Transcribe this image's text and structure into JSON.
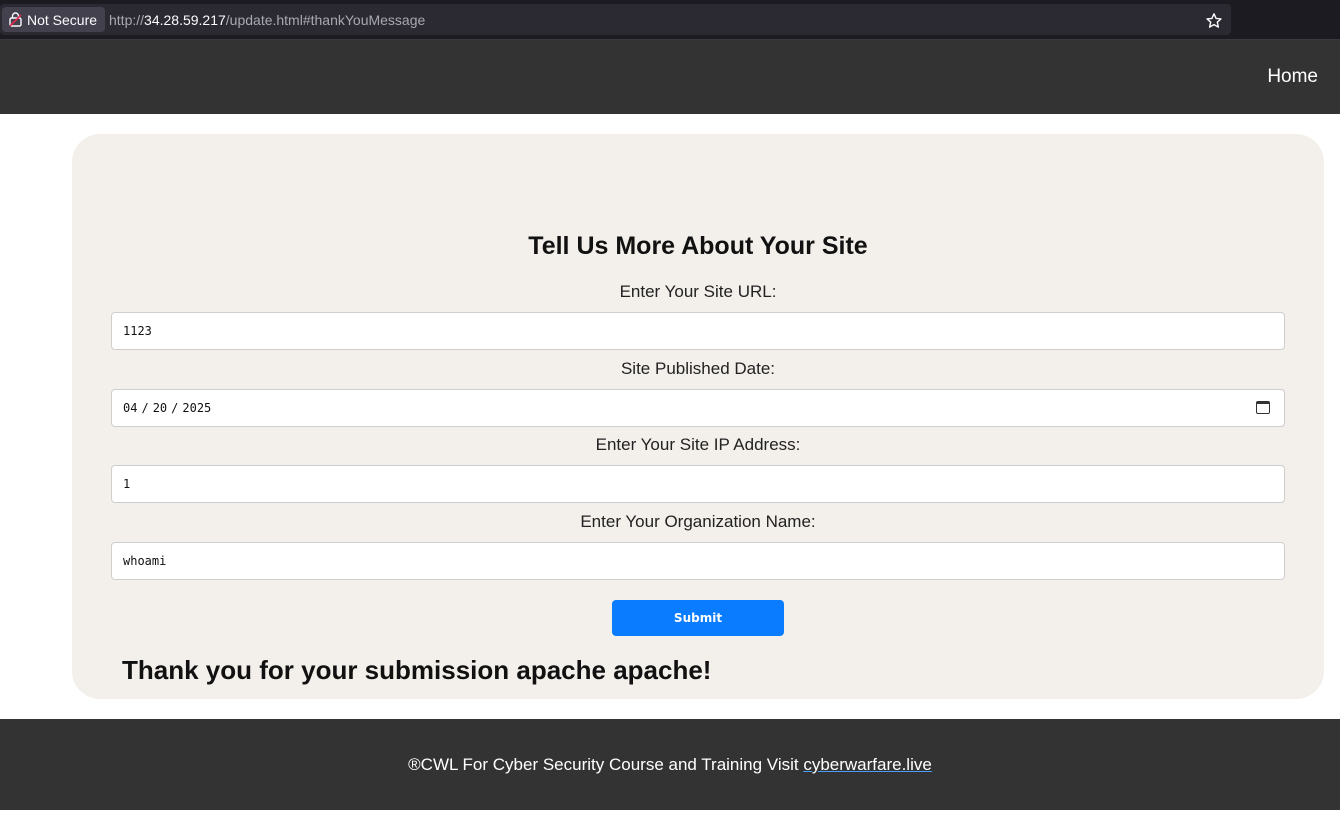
{
  "browser": {
    "security_label": "Not Secure",
    "url_prefix": "http://",
    "url_host": "34.28.59.217",
    "url_path": "/update.html#thankYouMessage"
  },
  "nav": {
    "home_label": "Home"
  },
  "form": {
    "title": "Tell Us More About Your Site",
    "site_url_label": "Enter Your Site URL:",
    "site_url_value": "1123",
    "date_label": "Site Published Date:",
    "date_month": "04",
    "date_day": "20",
    "date_year": "2025",
    "date_separator": "/",
    "ip_label": "Enter Your Site IP Address:",
    "ip_value": "1",
    "org_label": "Enter Your Organization Name:",
    "org_value": "whoami",
    "submit_label": "Submit"
  },
  "message": {
    "thank_you": "Thank you for your submission apache apache!"
  },
  "footer": {
    "text": "®CWL For Cyber Security Course and Training Visit ",
    "link_text": "cyberwarfare.live"
  },
  "colors": {
    "nav_bg": "#333333",
    "card_bg": "#f3efea",
    "submit_bg": "#0a7cff"
  },
  "icons": [
    "lock-warning-icon",
    "star-bookmark-icon",
    "calendar-icon"
  ]
}
